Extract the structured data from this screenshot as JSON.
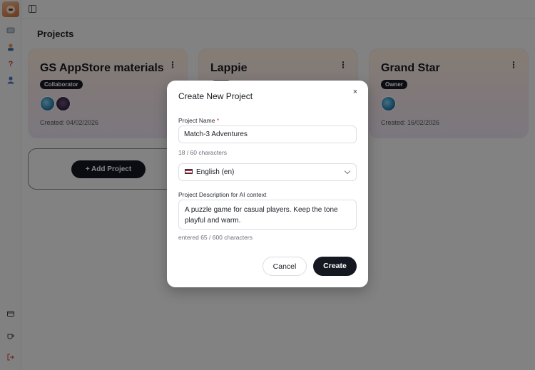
{
  "rail": {
    "logo": "cat-avatar",
    "top_icons": [
      "chat-icon",
      "profile-icon",
      "help-icon",
      "user-icon"
    ],
    "bottom_icons": [
      "card-icon",
      "coffee-icon",
      "logout-icon"
    ]
  },
  "page": {
    "title": "Projects"
  },
  "projects": [
    {
      "name": "GS AppStore materials",
      "role": "Collaborator",
      "created": "Created: 04/02/2026",
      "menu": "⋮"
    },
    {
      "name": "Lappie",
      "role": "",
      "created": "",
      "menu": "⋮"
    },
    {
      "name": "Grand Star",
      "role": "Owner",
      "created": "Created: 16/02/2026",
      "menu": "⋮"
    }
  ],
  "add_project": {
    "label": "+ Add Project"
  },
  "modal": {
    "title": "Create New Project",
    "close": "×",
    "name_label": "Project Name",
    "required_mark": "*",
    "name_value": "Match-3 Adventures",
    "name_counter": "18 / 60 characters",
    "language_value": "English (en)",
    "description_label": "Project Description for AI context",
    "description_value": "A puzzle game for casual players. Keep the tone playful and warm.",
    "description_counter": "entered 65 / 600 characters",
    "cancel_label": "Cancel",
    "create_label": "Create"
  },
  "colors": {
    "accent": "#151821",
    "required": "#d53b3b"
  }
}
